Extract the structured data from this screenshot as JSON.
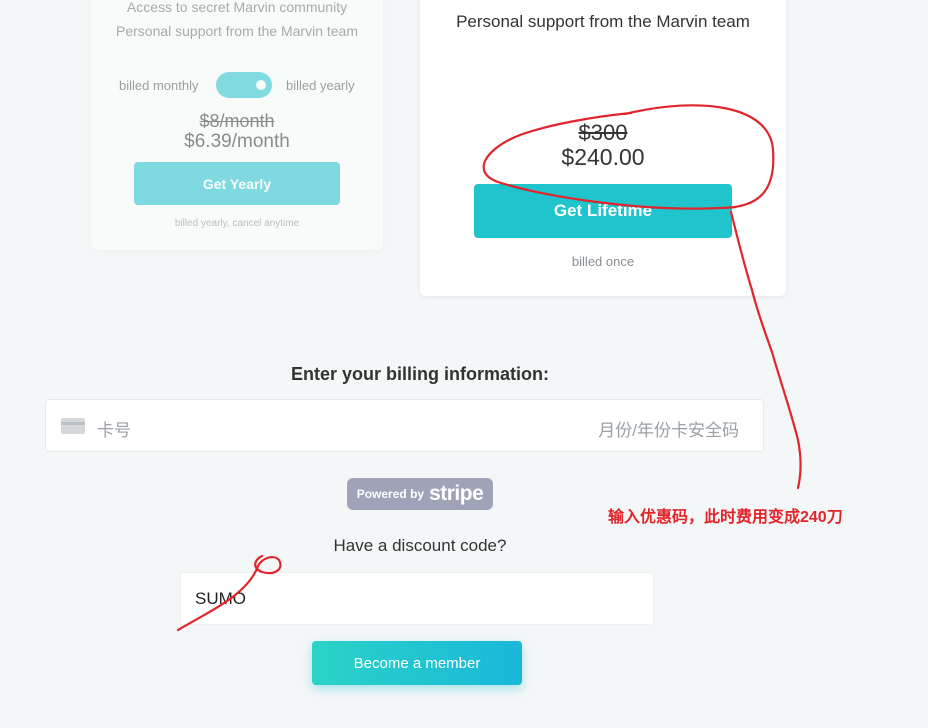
{
  "yearly_plan": {
    "features": [
      "Access to secret Marvin community",
      "Personal support from the Marvin team"
    ],
    "toggle": {
      "left_label": "billed monthly",
      "right_label": "billed yearly",
      "state": "yearly"
    },
    "old_price": "$8/month",
    "new_price": "$6.39/month",
    "button_label": "Get Yearly",
    "note": "billed yearly, cancel anytime"
  },
  "lifetime_plan": {
    "feature": "Personal support from the Marvin team",
    "old_price": "$300",
    "new_price": "$240.00",
    "button_label": "Get Lifetime",
    "note": "billed once"
  },
  "billing": {
    "heading": "Enter your billing information:",
    "card_placeholder": "卡号",
    "card_meta_placeholder": "月份/年份卡安全码",
    "card_icon": "credit-card-icon"
  },
  "stripe_badge": {
    "powered_by": "Powered by",
    "brand": "stripe"
  },
  "discount": {
    "label": "Have a discount code?",
    "value": "SUMO"
  },
  "submit": {
    "label": "Become a member"
  },
  "annotation": {
    "text": "输入优惠码，此时费用变成240刀",
    "color": "#e0252b"
  },
  "colors": {
    "accent": "#1fc4cd",
    "background": "#f3f7f8"
  }
}
